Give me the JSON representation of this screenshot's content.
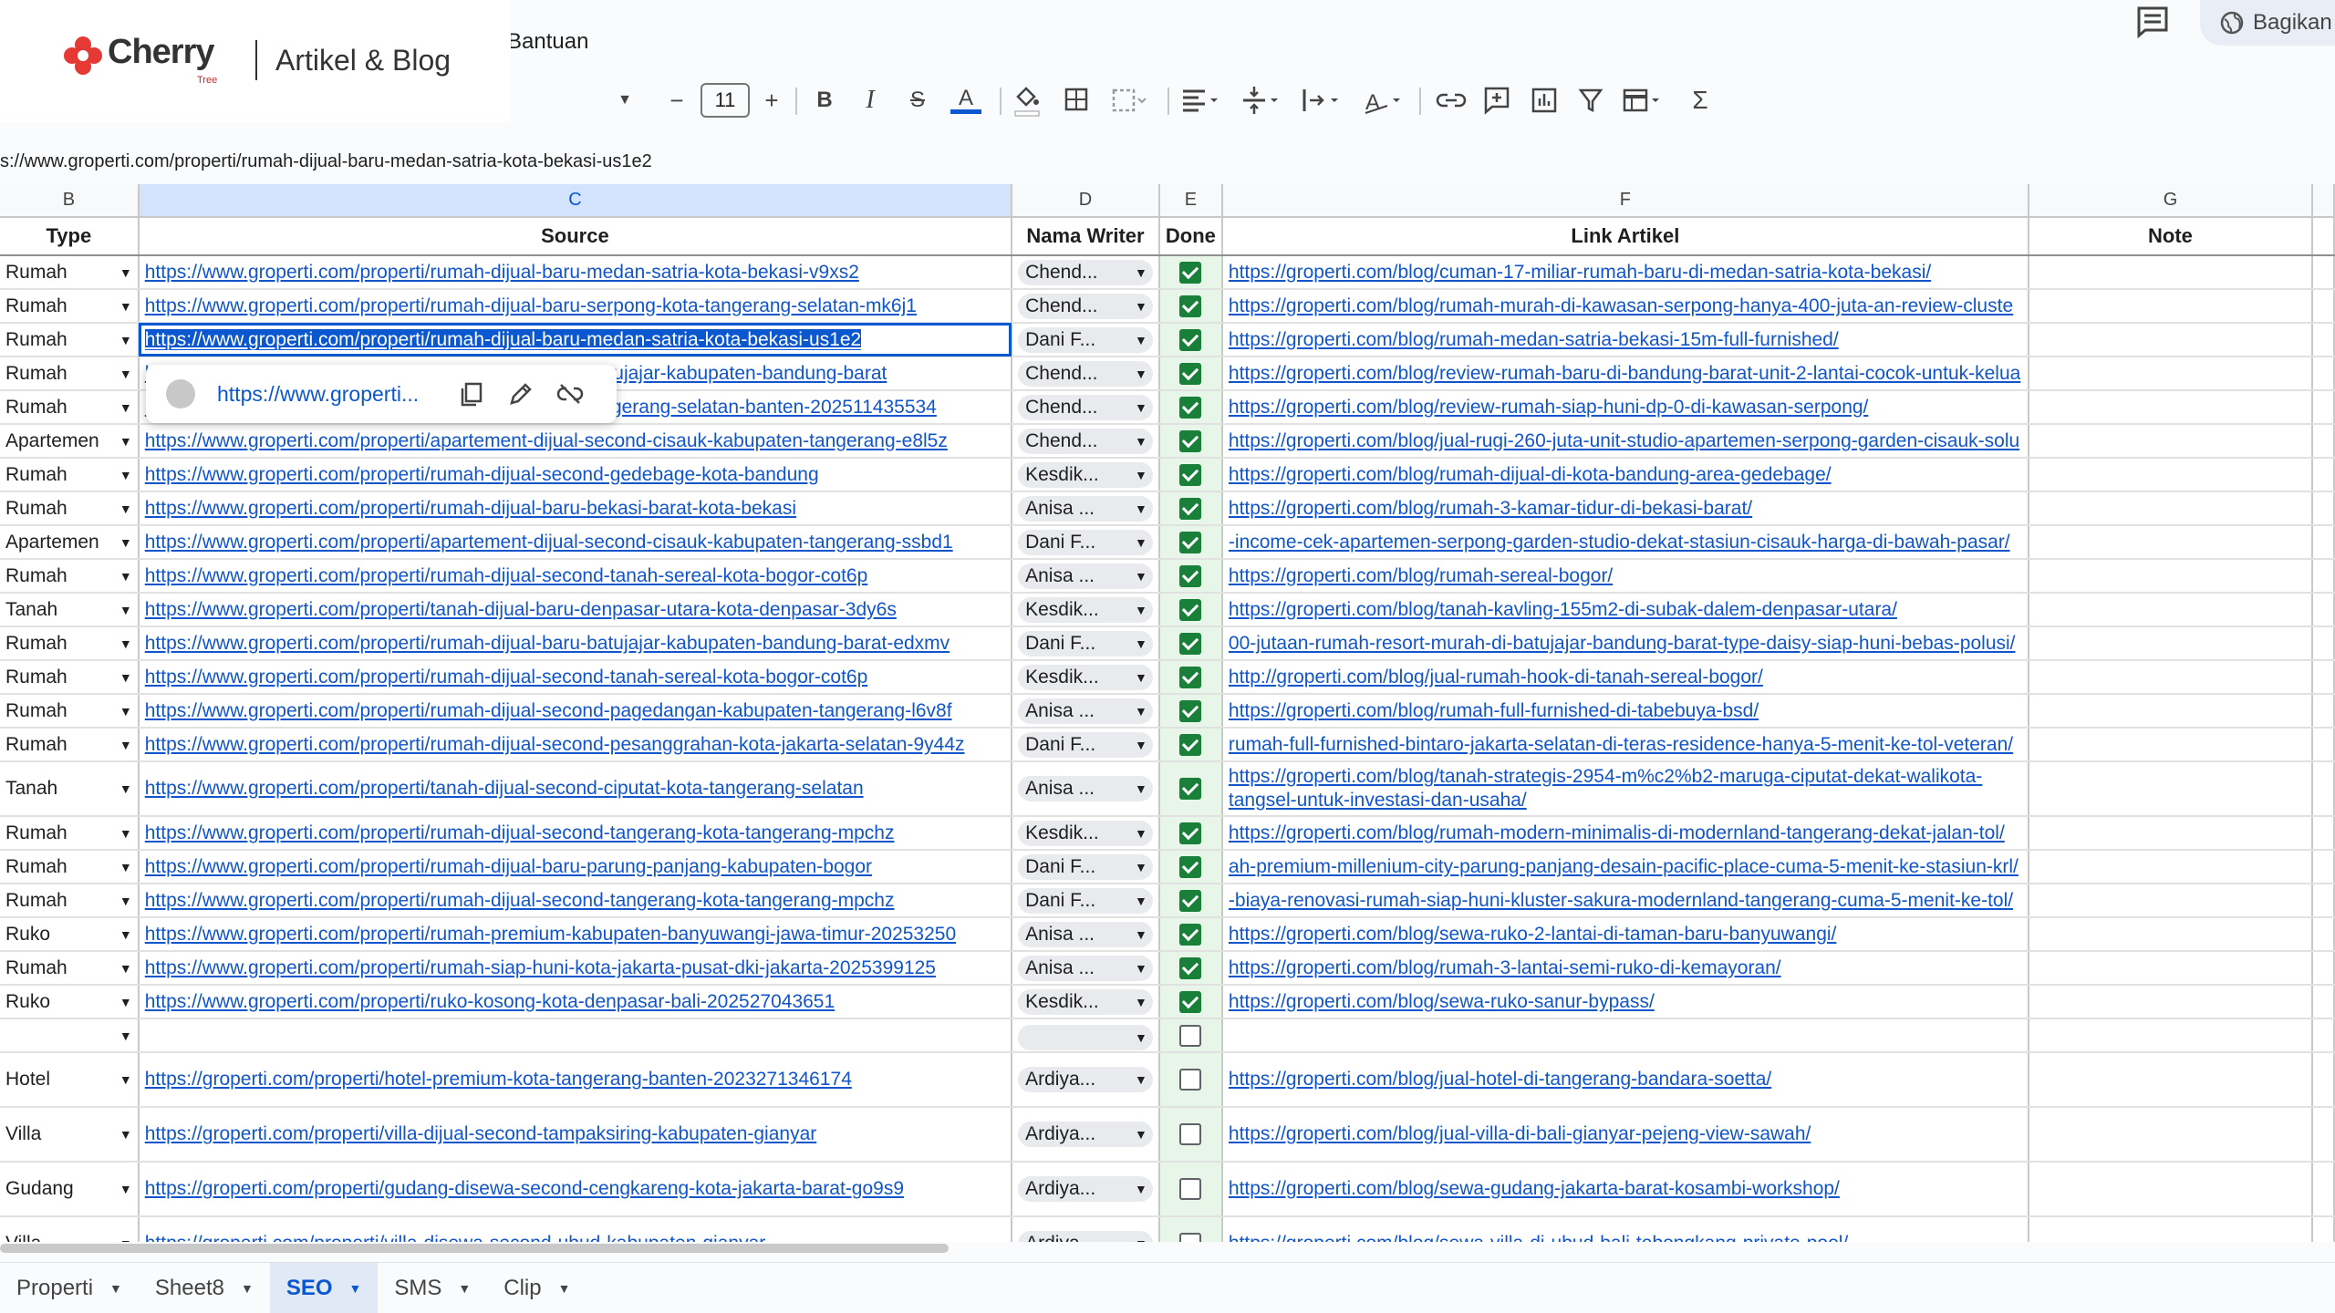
{
  "menu": {
    "help": "Bantuan"
  },
  "logo": {
    "name": "Cherry",
    "sub": "Tree",
    "tagline": "Artikel & Blog"
  },
  "header": {
    "share_label": "Bagikan"
  },
  "toolbar": {
    "font_size": "11"
  },
  "formula_bar": {
    "value": "s://www.groperti.com/properti/rumah-dijual-baru-medan-satria-kota-bekasi-us1e2"
  },
  "columns": [
    "B",
    "C",
    "D",
    "E",
    "F",
    "G"
  ],
  "headers": {
    "type": "Type",
    "source": "Source",
    "writer": "Nama Writer",
    "done": "Done",
    "link": "Link Artikel",
    "note": "Note"
  },
  "rows": [
    {
      "type": "Rumah",
      "source": "https://www.groperti.com/properti/rumah-dijual-baru-medan-satria-kota-bekasi-v9xs2",
      "writer": "Chend...",
      "done": true,
      "link": "https://groperti.com/blog/cuman-17-miliar-rumah-baru-di-medan-satria-kota-bekasi/"
    },
    {
      "type": "Rumah",
      "source": "https://www.groperti.com/properti/rumah-dijual-baru-serpong-kota-tangerang-selatan-mk6j1",
      "writer": "Chend...",
      "done": true,
      "link": "https://groperti.com/blog/rumah-murah-di-kawasan-serpong-hanya-400-juta-an-review-cluste"
    },
    {
      "type": "Rumah",
      "source": "https://www.groperti.com/properti/rumah-dijual-baru-medan-satria-kota-bekasi-us1e2",
      "writer": "Dani F...",
      "done": true,
      "link": "https://groperti.com/blog/rumah-medan-satria-bekasi-15m-full-furnished/"
    },
    {
      "type": "Rumah",
      "source": "https://www.groperti.com/properti/rumah-dijual-baru-batujajar-kabupaten-bandung-barat",
      "writer": "Chend...",
      "done": true,
      "link": "https://groperti.com/blog/review-rumah-baru-di-bandung-barat-unit-2-lantai-cocok-untuk-kelua"
    },
    {
      "type": "Rumah",
      "source": "https://www.groperti.com/properti/rumah-dijual-kota-tangerang-selatan-banten-202511435534",
      "writer": "Chend...",
      "done": true,
      "link": "https://groperti.com/blog/review-rumah-siap-huni-dp-0-di-kawasan-serpong/"
    },
    {
      "type": "Apartemen",
      "source": "https://www.groperti.com/properti/apartement-dijual-second-cisauk-kabupaten-tangerang-e8l5z",
      "writer": "Chend...",
      "done": true,
      "link": "https://groperti.com/blog/jual-rugi-260-juta-unit-studio-apartemen-serpong-garden-cisauk-solu"
    },
    {
      "type": "Rumah",
      "source": "https://www.groperti.com/properti/rumah-dijual-second-gedebage-kota-bandung",
      "writer": "Kesdik...",
      "done": true,
      "link": "https://groperti.com/blog/rumah-dijual-di-kota-bandung-area-gedebage/"
    },
    {
      "type": "Rumah",
      "source": "https://www.groperti.com/properti/rumah-dijual-baru-bekasi-barat-kota-bekasi",
      "writer": "Anisa ...",
      "done": true,
      "link": "https://groperti.com/blog/rumah-3-kamar-tidur-di-bekasi-barat/"
    },
    {
      "type": "Apartemen",
      "source": "https://www.groperti.com/properti/apartement-dijual-second-cisauk-kabupaten-tangerang-ssbd1",
      "writer": "Dani F...",
      "done": true,
      "link": "-income-cek-apartemen-serpong-garden-studio-dekat-stasiun-cisauk-harga-di-bawah-pasar/"
    },
    {
      "type": "Rumah",
      "source": "https://www.groperti.com/properti/rumah-dijual-second-tanah-sereal-kota-bogor-cot6p",
      "writer": "Anisa ...",
      "done": true,
      "link": "https://groperti.com/blog/rumah-sereal-bogor/"
    },
    {
      "type": "Tanah",
      "source": "https://www.groperti.com/properti/tanah-dijual-baru-denpasar-utara-kota-denpasar-3dy6s",
      "writer": "Kesdik...",
      "done": true,
      "link": "https://groperti.com/blog/tanah-kavling-155m2-di-subak-dalem-denpasar-utara/"
    },
    {
      "type": "Rumah",
      "source": "https://www.groperti.com/properti/rumah-dijual-baru-batujajar-kabupaten-bandung-barat-edxmv",
      "writer": "Dani F...",
      "done": true,
      "link": "00-jutaan-rumah-resort-murah-di-batujajar-bandung-barat-type-daisy-siap-huni-bebas-polusi/"
    },
    {
      "type": "Rumah",
      "source": "https://www.groperti.com/properti/rumah-dijual-second-tanah-sereal-kota-bogor-cot6p",
      "writer": "Kesdik...",
      "done": true,
      "link": "http://groperti.com/blog/jual-rumah-hook-di-tanah-sereal-bogor/"
    },
    {
      "type": "Rumah",
      "source": "https://www.groperti.com/properti/rumah-dijual-second-pagedangan-kabupaten-tangerang-l6v8f",
      "writer": "Anisa ...",
      "done": true,
      "link": "https://groperti.com/blog/rumah-full-furnished-di-tabebuya-bsd/"
    },
    {
      "type": "Rumah",
      "source": "https://www.groperti.com/properti/rumah-dijual-second-pesanggrahan-kota-jakarta-selatan-9y44z",
      "writer": "Dani F...",
      "done": true,
      "link": "rumah-full-furnished-bintaro-jakarta-selatan-di-teras-residence-hanya-5-menit-ke-tol-veteran/"
    },
    {
      "type": "Tanah",
      "source": "https://www.groperti.com/properti/tanah-dijual-second-ciputat-kota-tangerang-selatan",
      "writer": "Anisa ...",
      "done": true,
      "link": "https://groperti.com/blog/tanah-strategis-2954-m%c2%b2-maruga-ciputat-dekat-walikota-tangsel-untuk-investasi-dan-usaha/",
      "tall": true
    },
    {
      "type": "Rumah",
      "source": "https://www.groperti.com/properti/rumah-dijual-second-tangerang-kota-tangerang-mpchz",
      "writer": "Kesdik...",
      "done": true,
      "link": "https://groperti.com/blog/rumah-modern-minimalis-di-modernland-tangerang-dekat-jalan-tol/"
    },
    {
      "type": "Rumah",
      "source": "https://www.groperti.com/properti/rumah-dijual-baru-parung-panjang-kabupaten-bogor",
      "writer": "Dani F...",
      "done": true,
      "link": "ah-premium-millenium-city-parung-panjang-desain-pacific-place-cuma-5-menit-ke-stasiun-krl/"
    },
    {
      "type": "Rumah",
      "source": "https://www.groperti.com/properti/rumah-dijual-second-tangerang-kota-tangerang-mpchz",
      "writer": "Dani F...",
      "done": true,
      "link": "-biaya-renovasi-rumah-siap-huni-kluster-sakura-modernland-tangerang-cuma-5-menit-ke-tol/"
    },
    {
      "type": "Ruko",
      "source": "https://www.groperti.com/properti/rumah-premium-kabupaten-banyuwangi-jawa-timur-20253250",
      "writer": "Anisa ...",
      "done": true,
      "link": "https://groperti.com/blog/sewa-ruko-2-lantai-di-taman-baru-banyuwangi/"
    },
    {
      "type": "Rumah",
      "source": "https://www.groperti.com/properti/rumah-siap-huni-kota-jakarta-pusat-dki-jakarta-2025399125",
      "writer": "Anisa ...",
      "done": true,
      "link": "https://groperti.com/blog/rumah-3-lantai-semi-ruko-di-kemayoran/"
    },
    {
      "type": "Ruko",
      "source": "https://www.groperti.com/properti/ruko-kosong-kota-denpasar-bali-202527043651",
      "writer": "Kesdik...",
      "done": true,
      "link": "https://groperti.com/blog/sewa-ruko-sanur-bypass/"
    },
    {
      "type": "",
      "source": "",
      "writer": "",
      "done": false,
      "link": ""
    },
    {
      "type": "Hotel",
      "source": "https://groperti.com/properti/hotel-premium-kota-tangerang-banten-2023271346174",
      "writer": "Ardiya...",
      "done": false,
      "link": "https://groperti.com/blog/jual-hotel-di-tangerang-bandara-soetta/",
      "tall": true
    },
    {
      "type": "Villa",
      "source": "https://groperti.com/properti/villa-dijual-second-tampaksiring-kabupaten-gianyar",
      "writer": "Ardiya...",
      "done": false,
      "link": "https://groperti.com/blog/jual-villa-di-bali-gianyar-pejeng-view-sawah/",
      "tall": true
    },
    {
      "type": "Gudang",
      "source": "https://groperti.com/properti/gudang-disewa-second-cengkareng-kota-jakarta-barat-go9s9",
      "writer": "Ardiya...",
      "done": false,
      "link": "https://groperti.com/blog/sewa-gudang-jakarta-barat-kosambi-workshop/",
      "tall": true
    },
    {
      "type": "Villa",
      "source": "https://groperti.com/properti/villa-disewa-second-ubud-kabupaten-gianyar",
      "writer": "Ardiya...",
      "done": false,
      "link": "https://groperti.com/blog/sewa-villa-di-ubud-bali-tebongkang-private-pool/",
      "tall": true
    }
  ],
  "popup": {
    "url": "https://www.groperti..."
  },
  "sheets": [
    {
      "label": "Properti",
      "active": false
    },
    {
      "label": "Sheet8",
      "active": false
    },
    {
      "label": "SEO",
      "active": true
    },
    {
      "label": "SMS",
      "active": false
    },
    {
      "label": "Clip",
      "active": false
    }
  ],
  "colors": {
    "accent": "#0b57d0",
    "link": "#1155cc",
    "check": "#188038",
    "logo_red": "#e53935"
  }
}
